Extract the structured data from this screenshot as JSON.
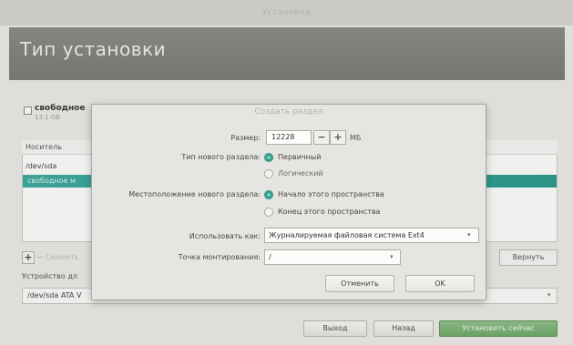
{
  "window": {
    "title": "Установка"
  },
  "page": {
    "title": "Тип установки"
  },
  "background": {
    "free_space": {
      "label": "свободное",
      "size": "13.1 GB"
    },
    "table": {
      "header": "Носитель",
      "rows": [
        "/dev/sda",
        "свободное м"
      ]
    },
    "buttons": {
      "plus": "+",
      "minus": "−",
      "change": "Сменить",
      "revert": "Вернуть"
    },
    "bootloader": {
      "label": "Устройство дл",
      "value": "/dev/sda ATA V"
    }
  },
  "dialog": {
    "title": "Создать раздел",
    "size": {
      "label": "Размер:",
      "value": "12228",
      "minus": "−",
      "plus": "+",
      "unit": "МБ"
    },
    "type": {
      "label": "Тип нового раздела:",
      "options": [
        "Первичный",
        "Логический"
      ],
      "selected": "Первичный"
    },
    "location": {
      "label": "Местоположение нового раздела:",
      "options": [
        "Начало этого пространства",
        "Конец этого пространства"
      ],
      "selected": "Начало этого пространства"
    },
    "use_as": {
      "label": "Использовать как:",
      "value": "Журналируемая файловая система Ext4"
    },
    "mount_point": {
      "label": "Точка монтирования:",
      "value": "/"
    },
    "buttons": {
      "cancel": "Отменить",
      "ok": "OK"
    }
  },
  "footer": {
    "quit": "Выход",
    "back": "Назад",
    "install": "Установить сейчас"
  },
  "colors": {
    "accent": "#3da696",
    "header": "#7e7e7a",
    "primary_button": "#6ea868"
  }
}
